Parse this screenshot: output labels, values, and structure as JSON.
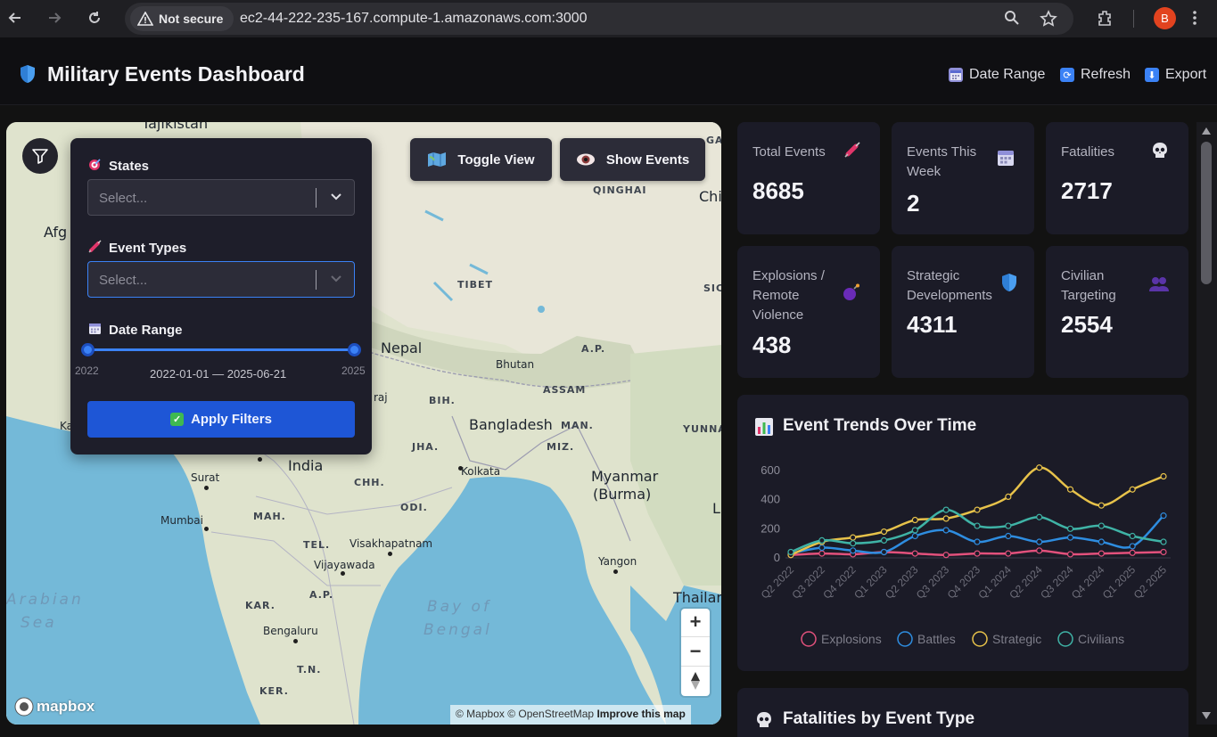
{
  "browser": {
    "security_label": "Not secure",
    "url": "ec2-44-222-235-167.compute-1.amazonaws.com:3000",
    "profile_initial": "B"
  },
  "header": {
    "title": "Military Events Dashboard",
    "actions": [
      {
        "label": "Date Range",
        "icon": "calendar-icon"
      },
      {
        "label": "Refresh",
        "icon": "refresh-icon"
      },
      {
        "label": "Export",
        "icon": "download-icon"
      }
    ]
  },
  "filters": {
    "states_label": "States",
    "states_placeholder": "Select...",
    "event_types_label": "Event Types",
    "event_types_placeholder": "Select...",
    "date_range_label": "Date Range",
    "date_min": "2022",
    "date_max": "2025",
    "date_value": "2022-01-01 — 2025-06-21",
    "apply_label": "Apply Filters"
  },
  "map": {
    "toggle_view_label": "Toggle View",
    "show_events_label": "Show Events",
    "labels": {
      "tajikistan": "Tajikistan",
      "afghanistan": "Afg",
      "qinghai": "QINGHAI",
      "china": "Chi",
      "tibet": "TIBET",
      "sichuan": "SIC",
      "nepal": "Nepal",
      "bhutan": "Bhutan",
      "ap": "A.P.",
      "assam": "ASSAM",
      "bih": "BIH.",
      "praj": "raj",
      "bangladesh": "Bangladesh",
      "man": "MAN.",
      "yunnan": "YUNNA",
      "jha": "JHA.",
      "miz": "MIZ.",
      "india": "India",
      "kolkata": "Kolkata",
      "myanmar": "Myanmar",
      "burma": "(Burma)",
      "surat": "Surat",
      "chh": "CHH.",
      "odi": "ODI.",
      "ka": "Ka",
      "mumbai": "Mumbai",
      "mah": "MAH.",
      "tel": "TEL.",
      "visakhapatnam": "Visakhapatnam",
      "vijayawada": "Vijayawada",
      "yangon": "Yangon",
      "thailand": "Thailan",
      "l": "L",
      "arabian": "Arabian",
      "sea": "Sea",
      "bay_of": "Bay of",
      "bengal": "Bengal",
      "apsouth": "A.P.",
      "kar": "KAR.",
      "bengaluru": "Bengaluru",
      "tn": "T.N.",
      "ker": "KER.",
      "ga": "GA"
    },
    "zoom_in": "+",
    "zoom_out": "−",
    "logo_text": "mapbox",
    "attribution": "© Mapbox © OpenStreetMap",
    "improve": "Improve this map"
  },
  "stats": [
    {
      "label": "Total Events",
      "value": "8685",
      "icon": "syringe-icon",
      "color": "#e0356a"
    },
    {
      "label": "Events This Week",
      "value": "2",
      "icon": "calendar-icon",
      "color": "#8f8fd8"
    },
    {
      "label": "Fatalities",
      "value": "2717",
      "icon": "skull-icon",
      "color": "#d8d8e0"
    },
    {
      "label": "Explosions / Remote Violence",
      "value": "438",
      "icon": "bomb-icon",
      "color": "#7a3bd0"
    },
    {
      "label": "Strategic Developments",
      "value": "4311",
      "icon": "shield-icon",
      "color": "#3d8fe8"
    },
    {
      "label": "Civilian Targeting",
      "value": "2554",
      "icon": "people-icon",
      "color": "#6a3dbd"
    }
  ],
  "trend_card": {
    "title": "Event Trends Over Time"
  },
  "fatalities_card": {
    "title": "Fatalities by Event Type"
  },
  "chart_data": {
    "type": "line",
    "title": "Event Trends Over Time",
    "categories": [
      "Q2 2022",
      "Q3 2022",
      "Q4 2022",
      "Q1 2023",
      "Q2 2023",
      "Q3 2023",
      "Q4 2023",
      "Q1 2024",
      "Q2 2024",
      "Q3 2024",
      "Q4 2024",
      "Q1 2025",
      "Q2 2025"
    ],
    "ylim": [
      0,
      600
    ],
    "yticks": [
      "600",
      "400",
      "200",
      "0"
    ],
    "legend_position": "bottom",
    "grid": false,
    "series": [
      {
        "name": "Explosions",
        "color": "#e2517c",
        "values": [
          20,
          30,
          25,
          40,
          30,
          20,
          30,
          30,
          50,
          25,
          30,
          35,
          40
        ]
      },
      {
        "name": "Battles",
        "color": "#2e8de0",
        "values": [
          30,
          70,
          50,
          40,
          150,
          190,
          110,
          150,
          110,
          140,
          110,
          80,
          290
        ]
      },
      {
        "name": "Strategic",
        "color": "#e7c24a",
        "values": [
          20,
          110,
          140,
          180,
          260,
          270,
          330,
          420,
          620,
          470,
          360,
          470,
          560
        ]
      },
      {
        "name": "Civilians",
        "color": "#3fb3a6",
        "values": [
          40,
          120,
          100,
          120,
          190,
          330,
          220,
          220,
          280,
          200,
          220,
          150,
          110
        ]
      }
    ]
  }
}
